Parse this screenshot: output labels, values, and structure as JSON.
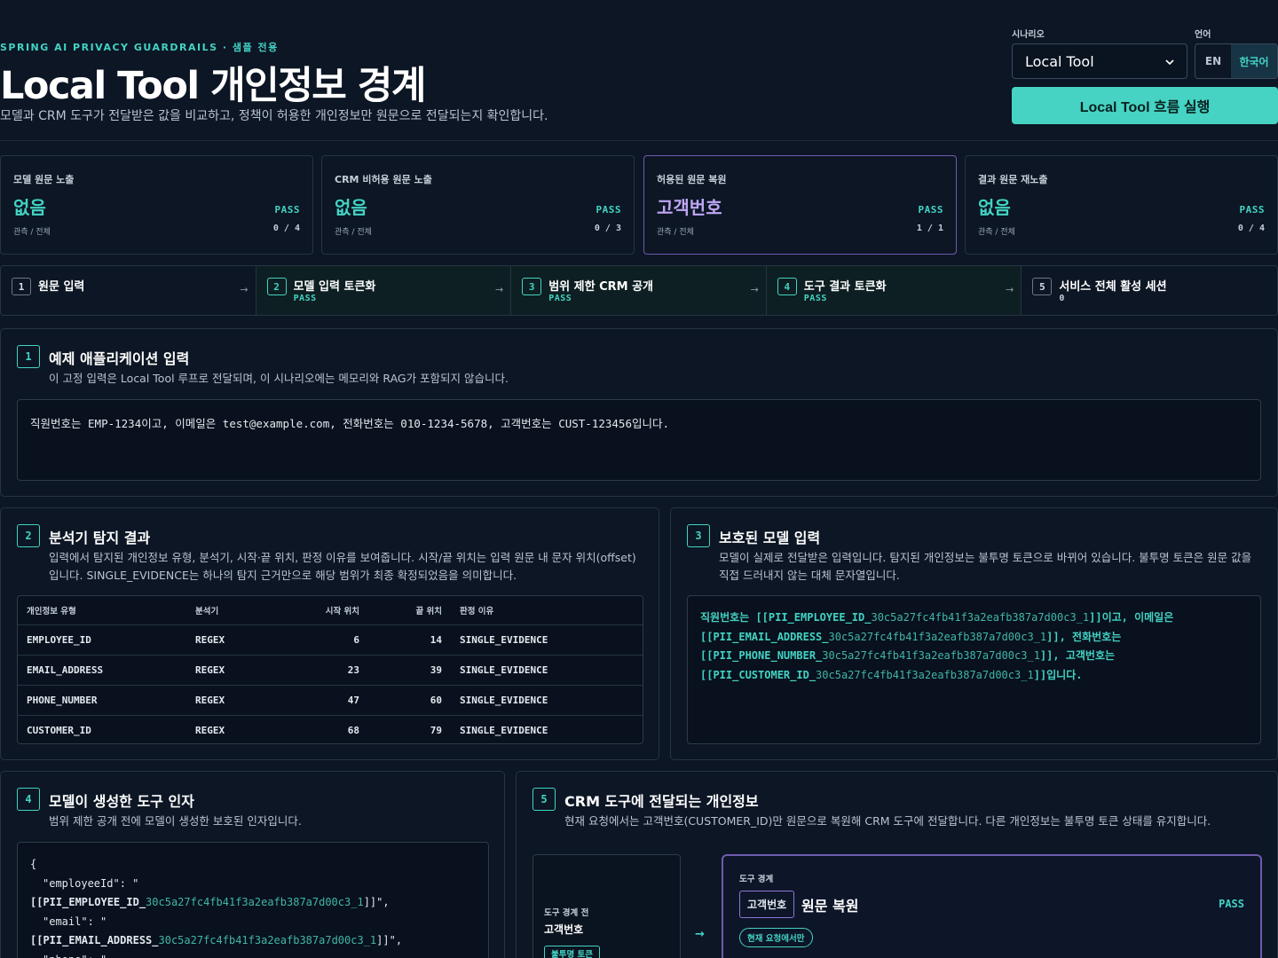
{
  "header": {
    "eyebrow": "SPRING AI PRIVACY GUARDRAILS · 샘플 전용",
    "title": "Local Tool 개인정보 경계",
    "subtitle": "모델과 CRM 도구가 전달받은 값을 비교하고, 정책이 허용한 개인정보만 원문으로 전달되는지 확인합니다."
  },
  "controls": {
    "scenario_label": "시나리오",
    "scenario_value": "Local Tool",
    "language_label": "언어",
    "lang_en": "EN",
    "lang_ko": "한국어",
    "run_button": "Local Tool 흐름 실행"
  },
  "metrics": [
    {
      "label": "모델 원문 노출",
      "value": "없음",
      "status": "PASS",
      "sub": "관측 / 전체",
      "count": "0 / 4"
    },
    {
      "label": "CRM 비허용 원문 노출",
      "value": "없음",
      "status": "PASS",
      "sub": "관측 / 전체",
      "count": "0 / 3"
    },
    {
      "label": "허용된 원문 복원",
      "value": "고객번호",
      "status": "PASS",
      "sub": "관측 / 전체",
      "count": "1 / 1"
    },
    {
      "label": "결과 원문 재노출",
      "value": "없음",
      "status": "PASS",
      "sub": "관측 / 전체",
      "count": "0 / 4"
    }
  ],
  "steps": [
    {
      "num": "1",
      "title": "원문 입력",
      "status": ""
    },
    {
      "num": "2",
      "title": "모델 입력 토큰화",
      "status": "PASS"
    },
    {
      "num": "3",
      "title": "범위 제한 CRM 공개",
      "status": "PASS"
    },
    {
      "num": "4",
      "title": "도구 결과 토큰화",
      "status": "PASS"
    },
    {
      "num": "5",
      "title": "서비스 전체 활성 세션",
      "status": "0"
    }
  ],
  "arrow": "→",
  "panel1": {
    "num": "1",
    "title": "예제 애플리케이션 입력",
    "desc": "이 고정 입력은 Local Tool 루프로 전달되며, 이 시나리오에는 메모리와 RAG가 포함되지 않습니다.",
    "input": "직원번호는 EMP-1234이고, 이메일은 test@example.com, 전화번호는 010-1234-5678, 고객번호는 CUST-123456입니다."
  },
  "panel2": {
    "num": "2",
    "title": "분석기 탐지 결과",
    "desc": "입력에서 탐지된 개인정보 유형, 분석기, 시작·끝 위치, 판정 이유를 보여줍니다. 시작/끝 위치는 입력 원문 내 문자 위치(offset)입니다. SINGLE_EVIDENCE는 하나의 탐지 근거만으로 해당 범위가 최종 확정되었음을 의미합니다.",
    "columns": [
      "개인정보 유형",
      "분석기",
      "시작 위치",
      "끝 위치",
      "판정 이유"
    ],
    "rows": [
      [
        "EMPLOYEE_ID",
        "REGEX",
        "6",
        "14",
        "SINGLE_EVIDENCE"
      ],
      [
        "EMAIL_ADDRESS",
        "REGEX",
        "23",
        "39",
        "SINGLE_EVIDENCE"
      ],
      [
        "PHONE_NUMBER",
        "REGEX",
        "47",
        "60",
        "SINGLE_EVIDENCE"
      ],
      [
        "CUSTOMER_ID",
        "REGEX",
        "68",
        "79",
        "SINGLE_EVIDENCE"
      ]
    ]
  },
  "panel3": {
    "num": "3",
    "title": "보호된 모델 입력",
    "desc": "모델이 실제로 전달받은 입력입니다. 탐지된 개인정보는 불투명 토큰으로 바뀌어 있습니다. 불투명 토큰은 원문 값을 직접 드러내지 않는 대체 문자열입니다.",
    "hash": "30c5a27fc4fb41f3a2eafb387a7d00c3_1",
    "line1_pre": "직원번호는 ",
    "tok1": "[[PII_EMPLOYEE_ID_",
    "line1_post": "]]이고, 이메일은",
    "tok2": "[[PII_EMAIL_ADDRESS_",
    "line2_post": "]], 전화번호는",
    "tok3": "[[PII_PHONE_NUMBER_",
    "line3_post": "]], 고객번호는",
    "tok4": "[[PII_CUSTOMER_ID_",
    "line4_post": "]]입니다."
  },
  "panel4": {
    "num": "4",
    "title": "모델이 생성한 도구 인자",
    "desc": "범위 제한 공개 전에 모델이 생성한 보호된 인자입니다.",
    "brace": "{",
    "key1": "\"employeeId\": \"",
    "tok1": "[[PII_EMPLOYEE_ID_",
    "hash": "30c5a27fc4fb41f3a2eafb387a7d00c3_1",
    "end1": "]]\",",
    "key2": "\"email\": \"",
    "tok2": "[[PII_EMAIL_ADDRESS_",
    "end2": "]]\",",
    "key3": "\"phone\": \""
  },
  "panel5": {
    "num": "5",
    "title": "CRM 도구에 전달되는 개인정보",
    "desc": "현재 요청에서는 고객번호(CUSTOMER_ID)만 원문으로 복원해 CRM 도구에 전달합니다. 다른 개인정보는 불투명 토큰 상태를 유지합니다.",
    "before_label": "도구 경계 전",
    "before_value": "고객번호",
    "before_badge": "불투명 토큰",
    "boundary_label": "도구 경계",
    "boundary_chip": "고객번호",
    "boundary_title": "원문 복원",
    "boundary_status": "PASS",
    "boundary_badge": "현재 요청에서만"
  }
}
